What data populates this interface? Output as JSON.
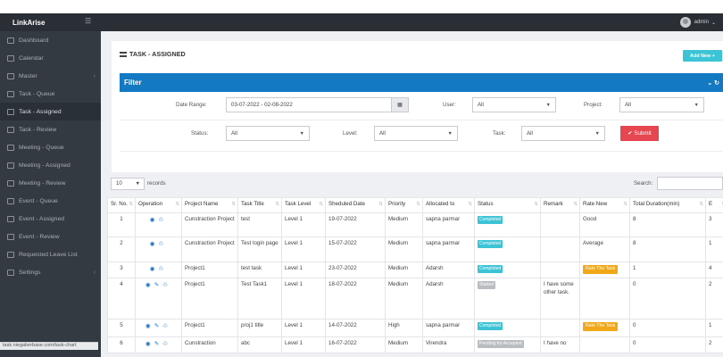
{
  "app": {
    "title": "LinkArise",
    "user": "admin"
  },
  "sidebar": {
    "items": [
      {
        "label": "Dashboard",
        "icon": "dashboard-icon",
        "chevron": false,
        "active": false
      },
      {
        "label": "Calendar",
        "icon": "calendar-icon",
        "chevron": false,
        "active": false
      },
      {
        "label": "Master",
        "icon": "list-icon",
        "chevron": true,
        "active": false
      },
      {
        "label": "Task - Queue",
        "icon": "list-icon",
        "chevron": false,
        "active": false
      },
      {
        "label": "Task - Assigned",
        "icon": "list-icon",
        "chevron": false,
        "active": true
      },
      {
        "label": "Task - Review",
        "icon": "list-icon",
        "chevron": false,
        "active": false
      },
      {
        "label": "Meeting - Queue",
        "icon": "meeting-icon",
        "chevron": false,
        "active": false
      },
      {
        "label": "Meeting - Assigned",
        "icon": "meeting-icon",
        "chevron": false,
        "active": false
      },
      {
        "label": "Meeting - Review",
        "icon": "meeting-icon",
        "chevron": false,
        "active": false
      },
      {
        "label": "Event - Queue",
        "icon": "event-icon",
        "chevron": false,
        "active": false
      },
      {
        "label": "Event - Assigned",
        "icon": "event-icon",
        "chevron": false,
        "active": false
      },
      {
        "label": "Event - Review",
        "icon": "event-icon",
        "chevron": false,
        "active": false
      },
      {
        "label": "Requested Leave List",
        "icon": "leave-icon",
        "chevron": false,
        "active": false
      },
      {
        "label": "Settings",
        "icon": "settings-icon",
        "chevron": true,
        "active": false
      }
    ],
    "status_url": "task.niegaberbase.com/task-chart"
  },
  "page": {
    "title": "TASK - ASSIGNED",
    "add_button": "Add New",
    "filter_title": "Filter"
  },
  "filters": {
    "date_range_label": "Date Range:",
    "date_range_value": "03-07-2022 - 02-08-2022",
    "user_label": "User:",
    "user_value": "All",
    "project_label": "Project:",
    "project_value": "All",
    "status_label": "Status:",
    "status_value": "All",
    "level_label": "Level:",
    "level_value": "All",
    "task_label": "Task:",
    "task_value": "All",
    "submit_label": "Submit"
  },
  "table_controls": {
    "length_value": "10",
    "length_suffix": "records",
    "search_label": "Search:"
  },
  "table": {
    "headers": [
      "Sr. No.",
      "Operation",
      "Project Name",
      "Task Title",
      "Task Level",
      "Sheduled Date",
      "Priority",
      "Allocated to",
      "Status",
      "Remark",
      "Rate New",
      "Total Duration(min)",
      "E"
    ],
    "rows": [
      {
        "sr": "1",
        "project": "Cunstraction Project",
        "title": "test",
        "level": "Level 1",
        "date": "19-07-2022",
        "priority": "Medium",
        "allocated": "sapna parmar",
        "status": "Completed",
        "status_color": "#3cc3d6",
        "remark": "",
        "rate": "Good",
        "rate_badge": false,
        "duration": "8",
        "e": "3"
      },
      {
        "sr": "2",
        "project": "Cunstraction Project",
        "title": "Test login page",
        "level": "Level 1",
        "date": "15-07-2022",
        "priority": "Medium",
        "allocated": "sapna parmar",
        "status": "Completed",
        "status_color": "#3cc3d6",
        "remark": "",
        "rate": "Average",
        "rate_badge": false,
        "duration": "8",
        "e": "1"
      },
      {
        "sr": "3",
        "project": "Project1",
        "title": "test task",
        "level": "Level 1",
        "date": "23-07-2022",
        "priority": "Medium",
        "allocated": "Adarsh",
        "status": "Completed",
        "status_color": "#3cc3d6",
        "remark": "",
        "rate": "Rate The Task",
        "rate_badge": true,
        "duration": "1",
        "e": "4"
      },
      {
        "sr": "4",
        "project": "Project1",
        "title": "Test Task1",
        "level": "Level 1",
        "date": "18-07-2022",
        "priority": "Medium",
        "allocated": "Adarsh",
        "status": "Started",
        "status_color": "#b9bcc0",
        "remark": "I have some other task.",
        "rate": "",
        "rate_badge": false,
        "duration": "0",
        "e": "2"
      },
      {
        "sr": "5",
        "project": "Project1",
        "title": "proj1 title",
        "level": "Level 1",
        "date": "14-07-2022",
        "priority": "High",
        "allocated": "sapna parmar",
        "status": "Completed",
        "status_color": "#3cc3d6",
        "remark": "",
        "rate": "Rate The Task",
        "rate_badge": true,
        "duration": "0",
        "e": "1"
      },
      {
        "sr": "6",
        "project": "Cunstraction",
        "title": "abc",
        "level": "Level 1",
        "date": "16-07-2022",
        "priority": "Medium",
        "allocated": "Virendra",
        "status": "Pending for Accepted",
        "status_color": "#b9bcc0",
        "remark": "I have no",
        "rate": "",
        "rate_badge": false,
        "duration": "0",
        "e": "2"
      }
    ]
  }
}
